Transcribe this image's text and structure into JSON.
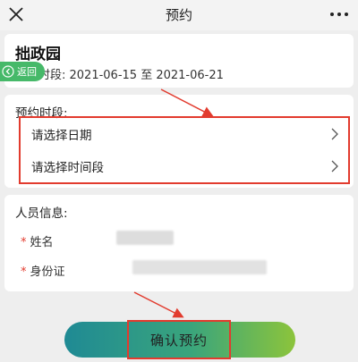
{
  "nav": {
    "title": "预约",
    "close_icon": "close-icon",
    "more_icon": "more-icon"
  },
  "venue": {
    "name": "拙政园",
    "period_text": "时段: 2021-06-15 至 2021-06-21",
    "back_label": "返回"
  },
  "booking": {
    "section_title": "预约时段:",
    "date_placeholder": "请选择日期",
    "time_placeholder": "请选择时间段"
  },
  "person": {
    "section_title": "人员信息:",
    "name_label": "姓名",
    "id_label": "身份证",
    "required_mark": "*"
  },
  "actions": {
    "confirm_label": "确认预约"
  },
  "colors": {
    "accent_green": "#46b969",
    "highlight_red": "#e23b2e",
    "button_gradient_start": "#1f8a94",
    "button_gradient_end": "#8cc43b"
  }
}
